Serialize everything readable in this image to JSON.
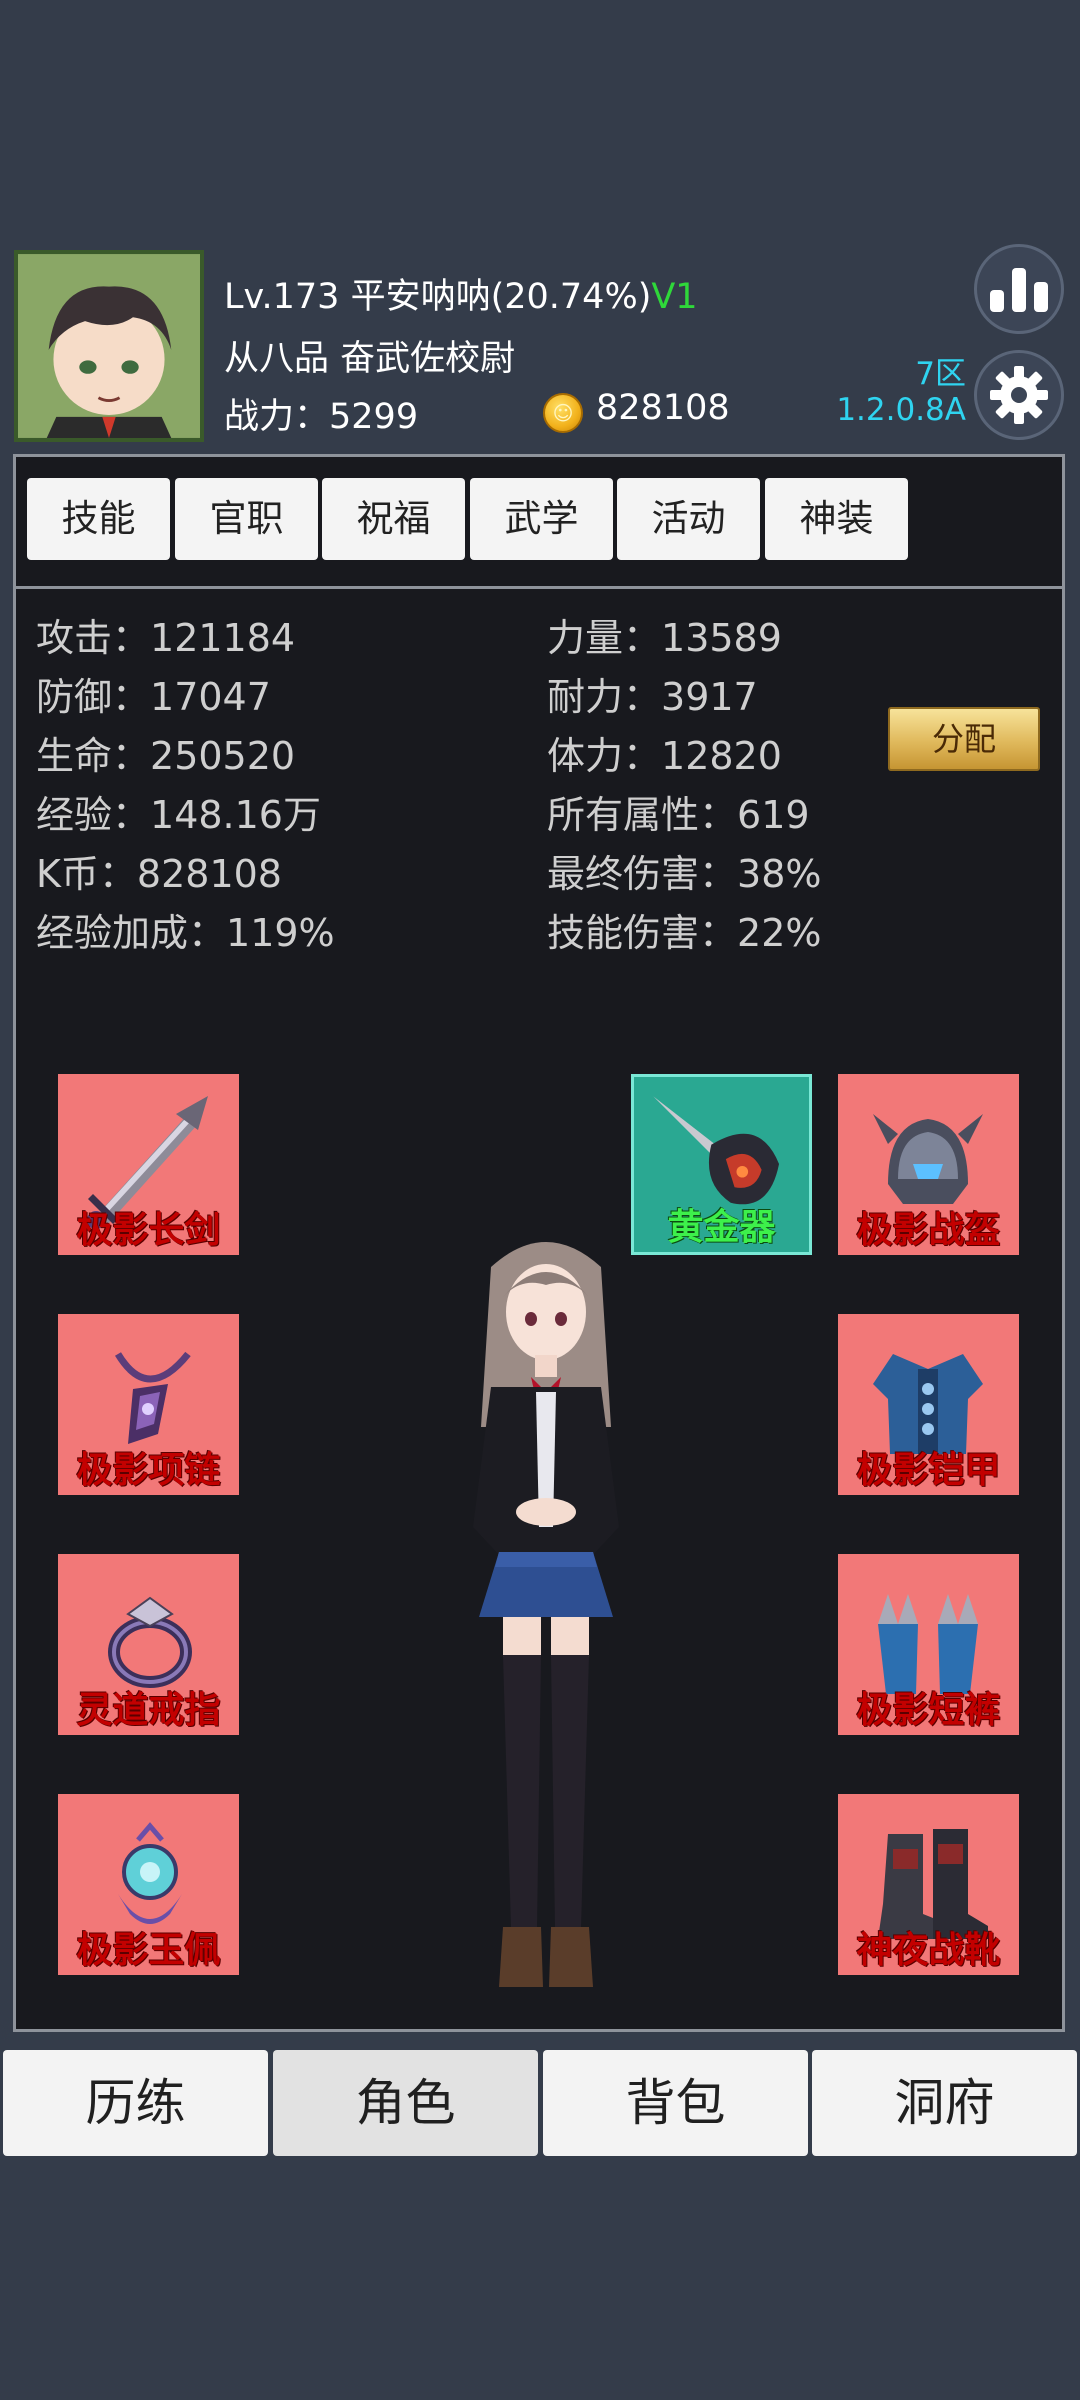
{
  "player": {
    "level": "Lv.173",
    "name": "平安呐呐",
    "exp_percent": "(20.74%)",
    "vip": "V1",
    "rank": "从八品 奋武佐校尉",
    "power_label": "战力：",
    "power_value": "5299",
    "coins": "828108",
    "server_zone": "7区",
    "version": "1.2.0.8A"
  },
  "tabs": [
    "技能",
    "官职",
    "祝福",
    "武学",
    "活动",
    "神装"
  ],
  "stats_left": [
    {
      "label": "攻击：",
      "value": "121184"
    },
    {
      "label": "防御：",
      "value": "17047"
    },
    {
      "label": "生命：",
      "value": "250520"
    },
    {
      "label": "经验：",
      "value": "148.16万"
    },
    {
      "label": "K币：",
      "value": "828108"
    },
    {
      "label": "经验加成：",
      "value": "119%"
    }
  ],
  "stats_right": [
    {
      "label": "力量：",
      "value": "13589"
    },
    {
      "label": "耐力：",
      "value": "3917"
    },
    {
      "label": "体力：",
      "value": "12820"
    },
    {
      "label": "所有属性：",
      "value": "619"
    },
    {
      "label": "最终伤害：",
      "value": "38%"
    },
    {
      "label": "技能伤害：",
      "value": "22%"
    }
  ],
  "assign_label": "分配",
  "equipment": {
    "left": [
      {
        "label": "极影长剑",
        "icon": "sword-icon"
      },
      {
        "label": "极影项链",
        "icon": "necklace-icon"
      },
      {
        "label": "灵道戒指",
        "icon": "ring-icon"
      },
      {
        "label": "极影玉佩",
        "icon": "jade-pendant-icon"
      }
    ],
    "right": [
      {
        "label": "极影战盔",
        "icon": "helmet-icon"
      },
      {
        "label": "极影铠甲",
        "icon": "armor-icon"
      },
      {
        "label": "极影短裤",
        "icon": "shorts-icon"
      },
      {
        "label": "神夜战靴",
        "icon": "boots-icon"
      }
    ],
    "special": {
      "label": "黄金器",
      "icon": "golden-weapon-icon"
    }
  },
  "bottom_nav": [
    "历练",
    "角色",
    "背包",
    "洞府"
  ],
  "bottom_nav_active": "角色",
  "colors": {
    "background": "#343c4a",
    "panel": "#18191e",
    "slot_bg": "#f27878",
    "slot_text": "#c30000",
    "gold_slot_bg": "#2aa892",
    "gold_slot_text": "#3df04b",
    "vip_green": "#2fd83a",
    "version_cyan": "#2fd4f0"
  }
}
